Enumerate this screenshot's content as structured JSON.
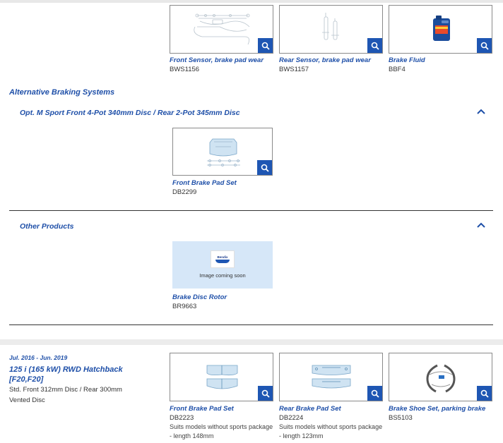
{
  "top_products": [
    {
      "title": "Front Sensor, brake pad wear",
      "code": "BWS1156",
      "icon": "sensor-wire-image"
    },
    {
      "title": "Rear Sensor, brake pad wear",
      "code": "BWS1157",
      "icon": "sensor-wire-image"
    },
    {
      "title": "Brake Fluid",
      "code": "BBF4",
      "icon": "fluid-bottle-image"
    }
  ],
  "alt_section": {
    "title": "Alternative Braking Systems",
    "group_title": "Opt. M Sport Front 4-Pot 340mm Disc / Rear 2-Pot 345mm Disc",
    "product": {
      "title": "Front Brake Pad Set",
      "code": "DB2299"
    }
  },
  "other_section": {
    "title": "Other Products",
    "product": {
      "title": "Brake Disc Rotor",
      "code": "BR9663",
      "placeholder_text": "Image coming soon",
      "logo_text": "Bendix"
    }
  },
  "vehicle": {
    "date_range": "Jul. 2016 - Jun. 2019",
    "name": "125 i (165 kW) RWD Hatchback [F20,F20]",
    "spec_line1": "Std. Front 312mm Disc / Rear 300mm",
    "spec_line2": "Vented Disc"
  },
  "bottom_products": [
    {
      "title": "Front Brake Pad Set",
      "code": "DB2223",
      "note": "Suits models without sports package - length 148mm"
    },
    {
      "title": "Rear Brake Pad Set",
      "code": "DB2224",
      "note": "Suits models without sports package - length 123mm"
    },
    {
      "title": "Brake Shoe Set, parking brake",
      "code": "BS5103",
      "note": ""
    }
  ],
  "colors": {
    "accent": "#1e4fa8",
    "button": "#1e56b3",
    "placeholder_bg": "#d6e7f8"
  }
}
